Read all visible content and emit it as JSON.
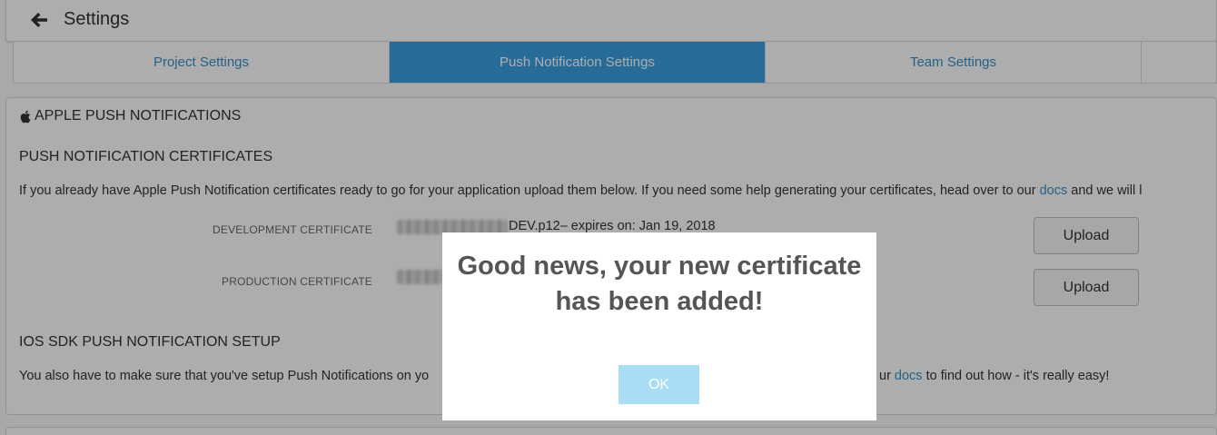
{
  "header": {
    "title": "Settings",
    "back_icon": "arrow-left-icon"
  },
  "tabs": [
    {
      "label": "Project Settings",
      "active": false
    },
    {
      "label": "Push Notification Settings",
      "active": true
    },
    {
      "label": "Team Settings",
      "active": false
    }
  ],
  "apple": {
    "section_title": "APPLE PUSH NOTIFICATIONS",
    "icon": "apple-icon",
    "certs_heading": "PUSH NOTIFICATION CERTIFICATES",
    "intro_text": "If you already have Apple Push Notification certificates ready to go for your application upload them below. If you need some help generating your certificates, head over to our ",
    "intro_link": "docs",
    "intro_after": " and we will l",
    "development": {
      "label": "DEVELOPMENT CERTIFICATE",
      "file_text": "DEV.p12– expires on: Jan 19, 2018",
      "upload_label": "Upload"
    },
    "production": {
      "label": "PRODUCTION CERTIFICATE",
      "upload_label": "Upload"
    },
    "sdk_heading": "IOS SDK PUSH NOTIFICATION SETUP",
    "sdk_text_start": "You also have to make sure that you've setup Push Notifications on yo",
    "sdk_text_mid": "ur ",
    "sdk_link": "docs",
    "sdk_text_end": " to find out how - it's really easy!"
  },
  "modal": {
    "message": "Good news, your new certificate has been added!",
    "ok_label": "OK"
  },
  "colors": {
    "accent": "#3a9fe0",
    "link": "#3a8fc7",
    "ok_button": "#a9dcf5"
  }
}
